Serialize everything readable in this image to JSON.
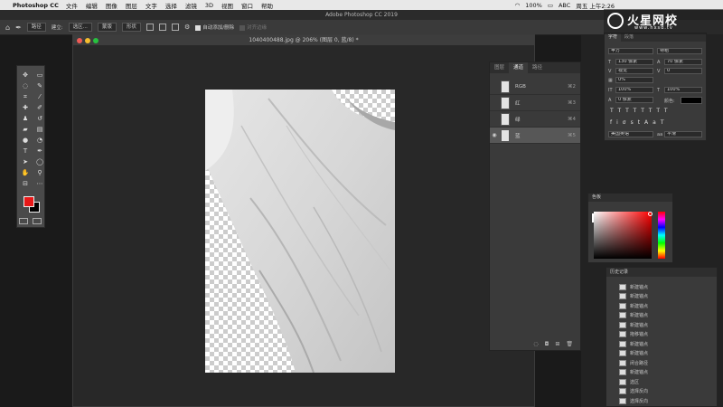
{
  "menubar": {
    "app": "Photoshop CC",
    "items": [
      "文件",
      "编辑",
      "图像",
      "图层",
      "文字",
      "选择",
      "滤镜",
      "3D",
      "视图",
      "窗口",
      "帮助"
    ],
    "battery": "100%",
    "input_method": "ABC",
    "clock": "周五 上午2:26"
  },
  "title": "Adobe Photoshop CC 2019",
  "options_bar": {
    "mode": "路径",
    "make_label": "建立:",
    "selection_btn": "选区...",
    "mask_btn": "蒙版",
    "shape_btn": "形状",
    "auto_add_delete": "自动添加/删除",
    "align_edges": "对齐边缘"
  },
  "watermark": {
    "brand": "火星网校",
    "url": "www.hxsd.tv"
  },
  "document": {
    "title": "1040400488.jpg @ 206% (图层 0, 蓝/8) *"
  },
  "channels_panel": {
    "tabs": [
      "图层",
      "通道",
      "路径"
    ],
    "active_tab": 1,
    "channels": [
      {
        "name": "RGB",
        "shortcut": "⌘2"
      },
      {
        "name": "红",
        "shortcut": "⌘3"
      },
      {
        "name": "绿",
        "shortcut": "⌘4"
      },
      {
        "name": "蓝",
        "shortcut": "⌘5"
      }
    ]
  },
  "character_panel": {
    "tabs": [
      "字符",
      "段落"
    ],
    "font_family": "苹方",
    "font_style": "特粗",
    "font_size": "130 像素",
    "leading": "70 像素",
    "kerning": "视觉",
    "tracking": "0",
    "scale_pct": "0%",
    "vertical_scale": "100%",
    "horizontal_scale": "100%",
    "baseline": "0 像素",
    "color_label": "颜色:",
    "language": "美国英语",
    "antialias": "平滑"
  },
  "color_panel": {
    "title": "色板"
  },
  "history_panel": {
    "title": "历史记录",
    "items": [
      "新建锚点",
      "新建锚点",
      "新建锚点",
      "新建锚点",
      "新建锚点",
      "拖移锚点",
      "新建锚点",
      "新建锚点",
      "闭合路径",
      "新建锚点",
      "选区",
      "选择反向",
      "选择反向",
      "..."
    ]
  },
  "colors": {
    "foreground": "#e81818",
    "background": "#000000"
  }
}
